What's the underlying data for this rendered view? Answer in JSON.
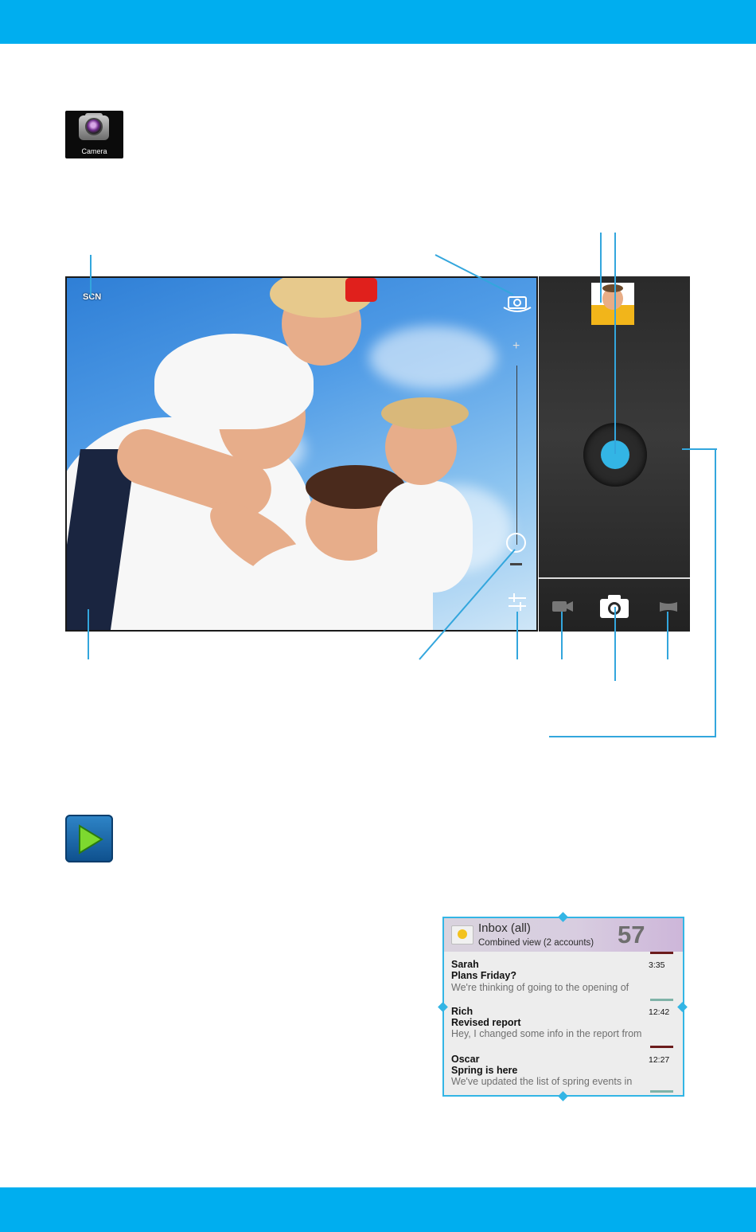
{
  "camera_app": {
    "icon": "camera-icon",
    "label": "Camera"
  },
  "viewfinder": {
    "scene_label": "SCN",
    "switch_camera_icon": "switch-camera-icon",
    "zoom_in_symbol": "+",
    "zoom_out_symbol": "–",
    "zoom_level": 0.15,
    "settings_icon": "settings-sliders-icon"
  },
  "controls": {
    "thumbnail": "last-photo-thumbnail",
    "shutter_icon": "shutter-button",
    "modes": [
      "video-camera-icon",
      "camera-icon",
      "panorama-icon"
    ],
    "selected_mode": "camera-icon"
  },
  "play_store": {
    "icon": "play-store-icon"
  },
  "email_widget": {
    "title": "Inbox (all)",
    "subtitle": "Combined view (2 accounts)",
    "count": "57",
    "messages": [
      {
        "from": "Sarah",
        "subject": "Plans Friday?",
        "preview": "We're thinking of going to the opening of",
        "time": "3:35",
        "color": "#6b1c1c"
      },
      {
        "from": "Rich",
        "subject": "Revised report",
        "preview": "Hey, I changed some info in the report from",
        "time": "12:42",
        "color": "#7fb3a8"
      },
      {
        "from": "Oscar",
        "subject": "Spring is here",
        "preview": "We've updated the list of spring events in",
        "time": "12:27",
        "color": "#6b1c1c"
      }
    ]
  },
  "colors": {
    "accent": "#00aeef",
    "callout": "#33a6dd",
    "shutter": "#33b5e5"
  }
}
